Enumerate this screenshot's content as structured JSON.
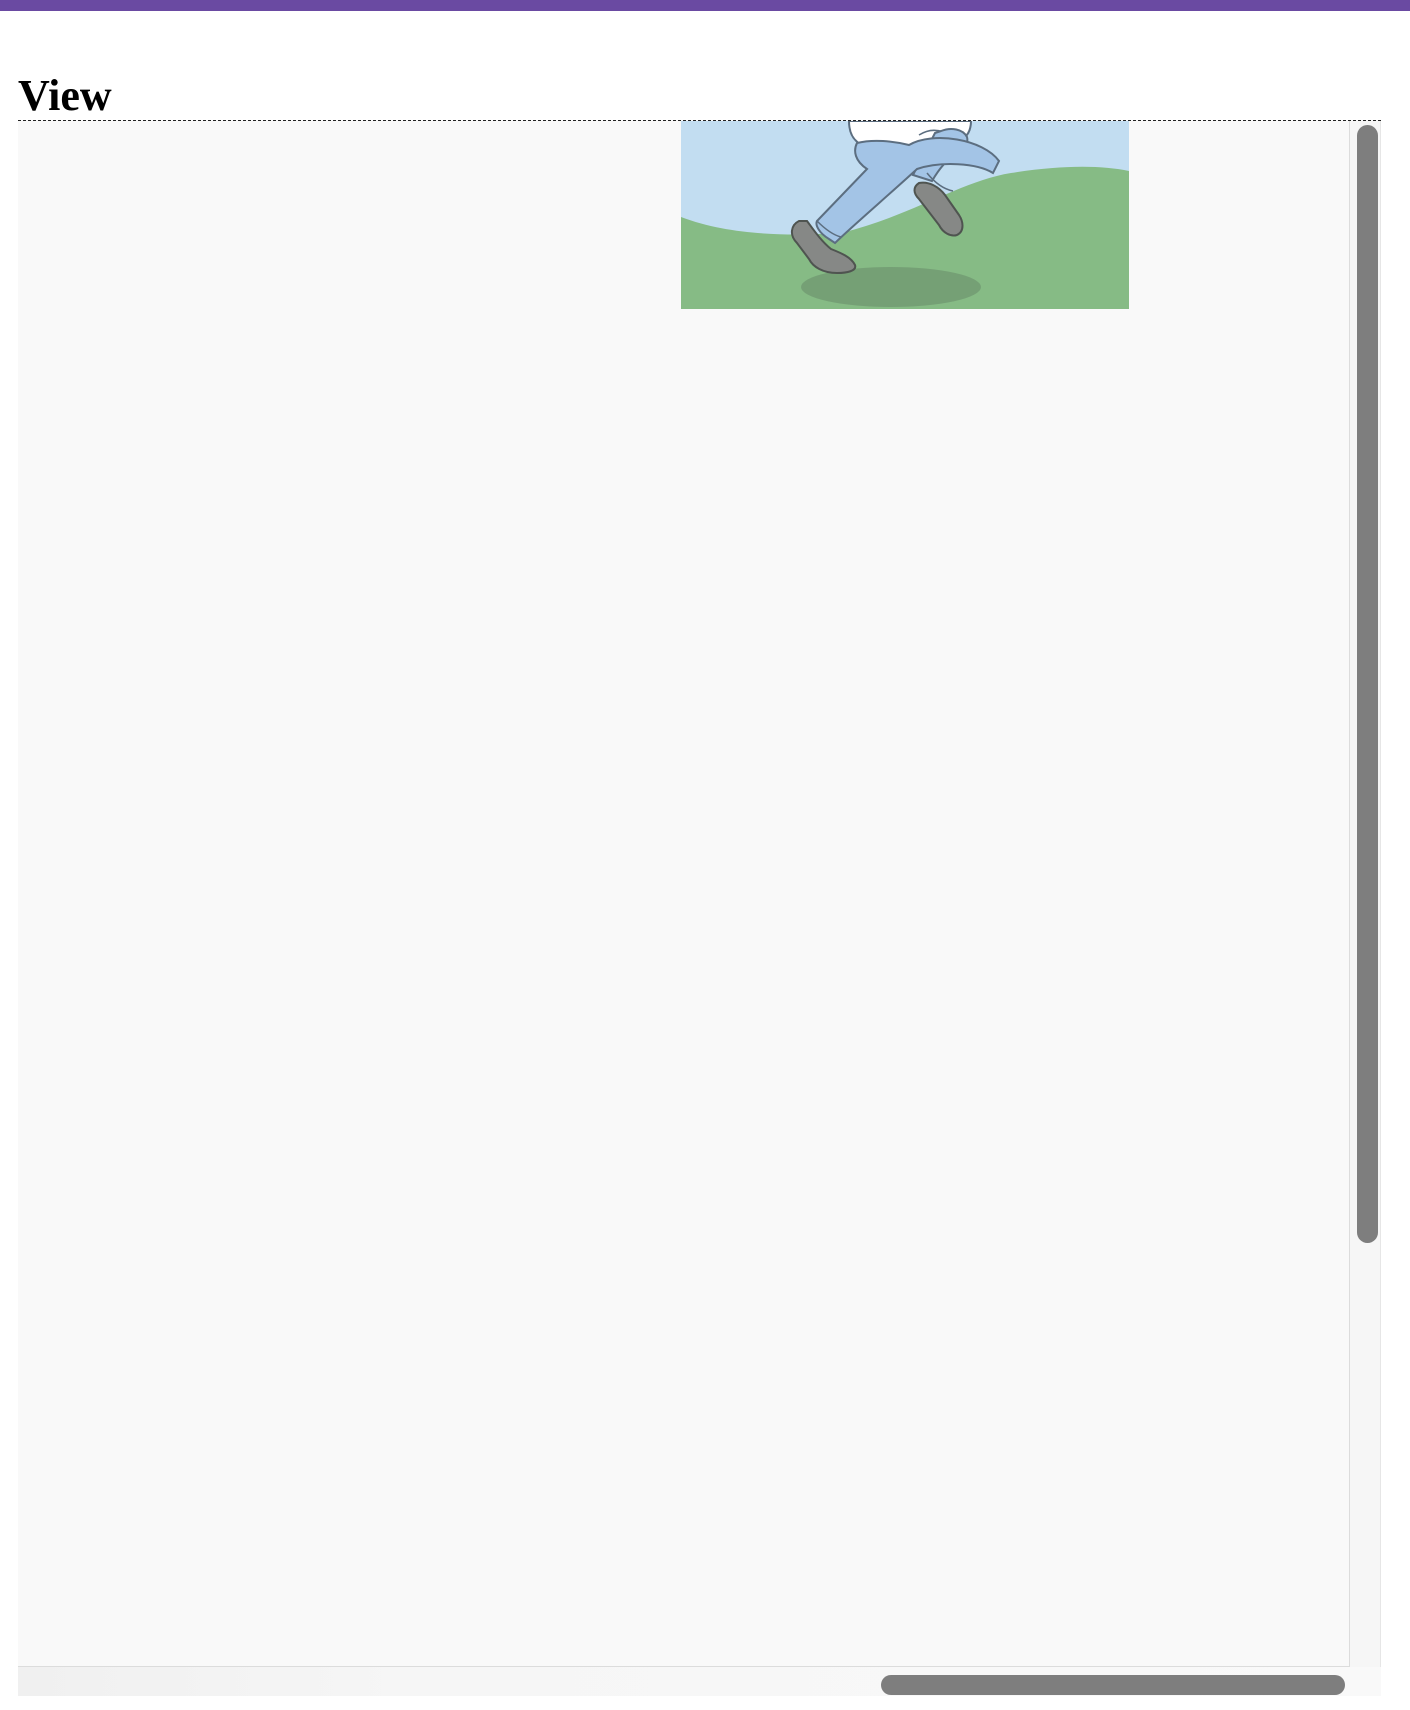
{
  "page": {
    "accent_bar_color": "#6a4aa2",
    "heading": "View"
  },
  "viewport": {
    "image": {
      "name": "running-figure-illustration",
      "sky_color": "#c2ddf1",
      "grass_color": "#86bb85",
      "pants_color": "#a3c4e6",
      "shoe_color": "#868886"
    },
    "vertical_scrollbar": {
      "thumb_color": "#7e7e7e"
    },
    "horizontal_scrollbar": {
      "thumb_color": "#7e7e7e"
    }
  }
}
